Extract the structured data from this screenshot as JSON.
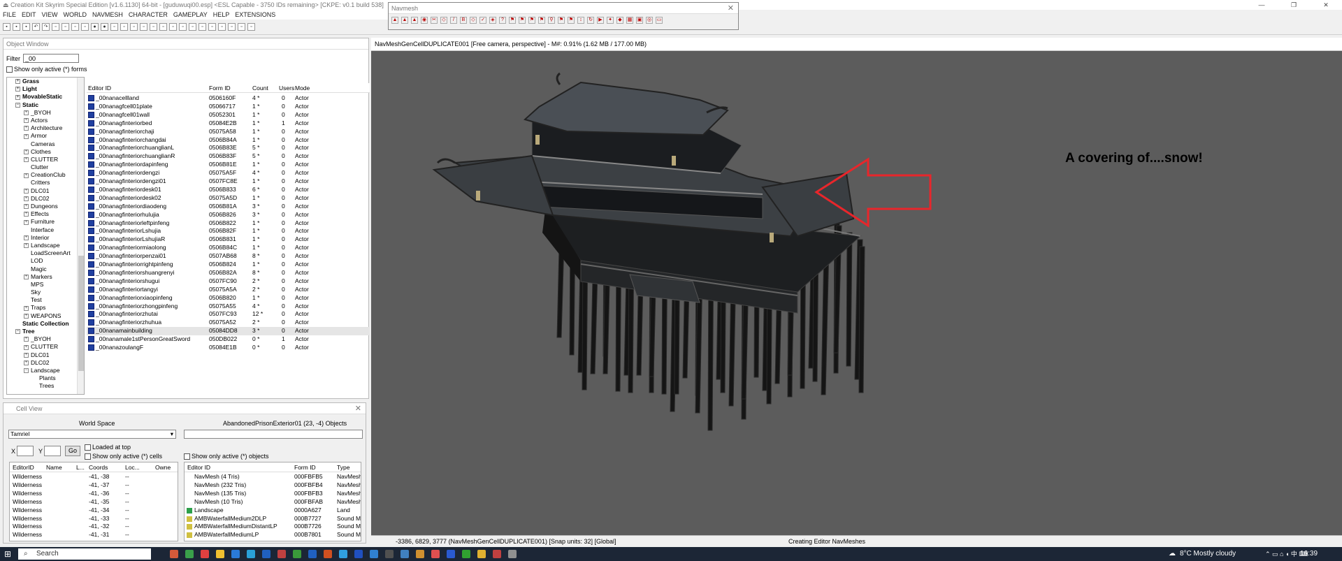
{
  "app": {
    "title": "Creation Kit Skyrim Special Edition [v1.6.1130] 64-bit - [guduwuqi00.esp] <ESL Capable - 3750 IDs remaining> [CKPE: v0.1 build 538]",
    "window_controls": [
      "—",
      "❐",
      "✕"
    ]
  },
  "menu": [
    "FILE",
    "EDIT",
    "VIEW",
    "WORLD",
    "NAVMESH",
    "CHARACTER",
    "GAMEPLAY",
    "HELP",
    "EXTENSIONS"
  ],
  "navmesh_toolbar": {
    "title": "Navmesh",
    "close": "✕"
  },
  "object_window": {
    "title": "Object Window",
    "filter_label": "Filter",
    "filter_value": "_00",
    "show_active": "Show only active (*) forms",
    "tree": [
      {
        "label": "Grass",
        "bold": true,
        "indent": 1,
        "exp": "+"
      },
      {
        "label": "Light",
        "bold": true,
        "indent": 1,
        "exp": "+"
      },
      {
        "label": "MovableStatic",
        "bold": true,
        "indent": 1,
        "exp": "+"
      },
      {
        "label": "Static",
        "bold": true,
        "indent": 1,
        "exp": "−"
      },
      {
        "label": "_BYOH",
        "indent": 2,
        "exp": "+"
      },
      {
        "label": "Actors",
        "indent": 2,
        "exp": "+"
      },
      {
        "label": "Architecture",
        "indent": 2,
        "exp": "+"
      },
      {
        "label": "Armor",
        "indent": 2,
        "exp": "+"
      },
      {
        "label": "Cameras",
        "indent": 2,
        "exp": ""
      },
      {
        "label": "Clothes",
        "indent": 2,
        "exp": "+"
      },
      {
        "label": "CLUTTER",
        "indent": 2,
        "exp": "+"
      },
      {
        "label": "Clutter",
        "indent": 2,
        "exp": ""
      },
      {
        "label": "CreationClub",
        "indent": 2,
        "exp": "+"
      },
      {
        "label": "Critters",
        "indent": 2,
        "exp": ""
      },
      {
        "label": "DLC01",
        "indent": 2,
        "exp": "+"
      },
      {
        "label": "DLC02",
        "indent": 2,
        "exp": "+"
      },
      {
        "label": "Dungeons",
        "indent": 2,
        "exp": "+"
      },
      {
        "label": "Effects",
        "indent": 2,
        "exp": "+"
      },
      {
        "label": "Furniture",
        "indent": 2,
        "exp": "+"
      },
      {
        "label": "Interface",
        "indent": 2,
        "exp": ""
      },
      {
        "label": "Interior",
        "indent": 2,
        "exp": "+"
      },
      {
        "label": "Landscape",
        "indent": 2,
        "exp": "+"
      },
      {
        "label": "LoadScreenArt",
        "indent": 2,
        "exp": ""
      },
      {
        "label": "LOD",
        "indent": 2,
        "exp": ""
      },
      {
        "label": "Magic",
        "indent": 2,
        "exp": ""
      },
      {
        "label": "Markers",
        "indent": 2,
        "exp": "+"
      },
      {
        "label": "MPS",
        "indent": 2,
        "exp": ""
      },
      {
        "label": "Sky",
        "indent": 2,
        "exp": ""
      },
      {
        "label": "Test",
        "indent": 2,
        "exp": ""
      },
      {
        "label": "Traps",
        "indent": 2,
        "exp": "+"
      },
      {
        "label": "WEAPONS",
        "indent": 2,
        "exp": "+"
      },
      {
        "label": "Static Collection",
        "bold": true,
        "indent": 1,
        "exp": ""
      },
      {
        "label": "Tree",
        "bold": true,
        "indent": 1,
        "exp": "−"
      },
      {
        "label": "_BYOH",
        "indent": 2,
        "exp": "+"
      },
      {
        "label": "CLUTTER",
        "indent": 2,
        "exp": "+"
      },
      {
        "label": "DLC01",
        "indent": 2,
        "exp": "+"
      },
      {
        "label": "DLC02",
        "indent": 2,
        "exp": "+"
      },
      {
        "label": "Landscape",
        "indent": 2,
        "exp": "−"
      },
      {
        "label": "Plants",
        "indent": 3,
        "exp": ""
      },
      {
        "label": "Trees",
        "indent": 3,
        "exp": ""
      }
    ],
    "columns": [
      "Editor ID",
      "Form ID",
      "Count",
      "Users",
      "Mode"
    ],
    "rows": [
      [
        "_00nanacellland",
        "0506160F",
        "4 *",
        "0",
        "Actor"
      ],
      [
        "_00nanagfcell01plate",
        "05066717",
        "1 *",
        "0",
        "Actor"
      ],
      [
        "_00nanagfcell01wall",
        "05052301",
        "1 *",
        "0",
        "Actor"
      ],
      [
        "_00nanagfinteriorbed",
        "05084E2B",
        "1 *",
        "1",
        "Actor"
      ],
      [
        "_00nanagfinteriorchaji",
        "05075A58",
        "1 *",
        "0",
        "Actor"
      ],
      [
        "_00nanagfinteriorchangdai",
        "0506B84A",
        "1 *",
        "0",
        "Actor"
      ],
      [
        "_00nanagfinteriorchuanglianL",
        "0506B83E",
        "5 *",
        "0",
        "Actor"
      ],
      [
        "_00nanagfinteriorchuanglianR",
        "0506B83F",
        "5 *",
        "0",
        "Actor"
      ],
      [
        "_00nanagfinteriordapinfeng",
        "0506B81E",
        "1 *",
        "0",
        "Actor"
      ],
      [
        "_00nanagfinteriordengzi",
        "05075A5F",
        "4 *",
        "0",
        "Actor"
      ],
      [
        "_00nanagfinteriordengzi01",
        "0507FC8E",
        "1 *",
        "0",
        "Actor"
      ],
      [
        "_00nanagfinteriordesk01",
        "0506B833",
        "6 *",
        "0",
        "Actor"
      ],
      [
        "_00nanagfinteriordesk02",
        "05075A5D",
        "1 *",
        "0",
        "Actor"
      ],
      [
        "_00nanagfinteriordiaodeng",
        "0506B81A",
        "3 *",
        "0",
        "Actor"
      ],
      [
        "_00nanagfinteriorhulujia",
        "0506B826",
        "3 *",
        "0",
        "Actor"
      ],
      [
        "_00nanagfinteriorleftpinfeng",
        "0506B822",
        "1 *",
        "0",
        "Actor"
      ],
      [
        "_00nanagfinteriorLshujia",
        "0506B82F",
        "1 *",
        "0",
        "Actor"
      ],
      [
        "_00nanagfinteriorLshujiaR",
        "0506B831",
        "1 *",
        "0",
        "Actor"
      ],
      [
        "_00nanagfinteriormiaolong",
        "0506B84C",
        "1 *",
        "0",
        "Actor"
      ],
      [
        "_00nanagfinteriorpenzai01",
        "0507AB68",
        "8 *",
        "0",
        "Actor"
      ],
      [
        "_00nanagfinteriorrightpinfeng",
        "0506B824",
        "1 *",
        "0",
        "Actor"
      ],
      [
        "_00nanagfinteriorshuangrenyi",
        "0506B82A",
        "8 *",
        "0",
        "Actor"
      ],
      [
        "_00nanagfinteriorshugui",
        "0507FC90",
        "2 *",
        "0",
        "Actor"
      ],
      [
        "_00nanagfinteriortangyi",
        "05075A5A",
        "2 *",
        "0",
        "Actor"
      ],
      [
        "_00nanagfinteriorxiaopinfeng",
        "0506B820",
        "1 *",
        "0",
        "Actor"
      ],
      [
        "_00nanagfinteriorzhongpinfeng",
        "05075A55",
        "4 *",
        "0",
        "Actor"
      ],
      [
        "_00nanagfinteriorzhutai",
        "0507FC93",
        "12 *",
        "0",
        "Actor"
      ],
      [
        "_00nanagfinteriorzhuhua",
        "05075A52",
        "2 *",
        "0",
        "Actor"
      ],
      [
        "_00nanamainbuilding",
        "05084DD8",
        "3 *",
        "0",
        "Actor"
      ],
      [
        "_00nanamale1stPersonGreatSword",
        "050DB022",
        "0 *",
        "1",
        "Actor"
      ],
      [
        "_00nanazoulangF",
        "05084E1B",
        "0 *",
        "0",
        "Actor"
      ]
    ]
  },
  "cell_view": {
    "title": "Cell View",
    "world_space_label": "World Space",
    "world_space_value": "Tamriel",
    "objects_label": "AbandonedPrisonExterior01 (23, -4) Objects",
    "x_label": "X",
    "y_label": "Y",
    "go": "Go",
    "loaded_at_top": "Loaded at top",
    "show_active_cells": "Show only active (*) cells",
    "show_active_objects": "Show only active (*) objects",
    "cell_columns": [
      "EditorID",
      "Name",
      "L...",
      "Coords",
      "Loc...",
      "Owne"
    ],
    "cells": [
      [
        "Wilderness",
        "",
        "",
        "-41, -38",
        "--",
        ""
      ],
      [
        "Wilderness",
        "",
        "",
        "-41, -37",
        "--",
        ""
      ],
      [
        "Wilderness",
        "",
        "",
        "-41, -36",
        "--",
        ""
      ],
      [
        "Wilderness",
        "",
        "",
        "-41, -35",
        "--",
        ""
      ],
      [
        "Wilderness",
        "",
        "",
        "-41, -34",
        "--",
        ""
      ],
      [
        "Wilderness",
        "",
        "",
        "-41, -33",
        "--",
        ""
      ],
      [
        "Wilderness",
        "",
        "",
        "-41, -32",
        "--",
        ""
      ],
      [
        "Wilderness",
        "",
        "",
        "-41, -31",
        "--",
        ""
      ]
    ],
    "object_columns": [
      "Editor ID",
      "Form ID",
      "Type"
    ],
    "objects": [
      [
        "NavMesh  (4 Tris)",
        "000FBFB5",
        "NavMesh"
      ],
      [
        "NavMesh  (232 Tris)",
        "000FBFB4",
        "NavMesh"
      ],
      [
        "NavMesh  (135 Tris)",
        "000FBFB3",
        "NavMesh"
      ],
      [
        "NavMesh  (10 Tris)",
        "000FBFAB",
        "NavMesh"
      ],
      [
        "Landscape",
        "0000A627",
        "Land"
      ],
      [
        "AMBWaterfallMedium2DLP",
        "000B7727",
        "Sound Mar"
      ],
      [
        "AMBWaterfallMediumDistantLP",
        "000B7726",
        "Sound Mar"
      ],
      [
        "AMBWaterfallMediumLP",
        "000B7801",
        "Sound Mar"
      ]
    ]
  },
  "viewport": {
    "header": "NavMeshGenCellDUPLICATE001 [Free camera, perspective] - M#: 0.91% (1.62 MB / 177.00 MB)",
    "annotation": "A covering of....snow!",
    "arrow_color": "#e8262b",
    "bg_color": "#5c5c5c"
  },
  "status": {
    "coords": "-3386, 6829, 3777 (NavMeshGenCellDUPLICATE001) [Snap units: 32] [Global]",
    "message": "Creating Editor NavMeshes"
  },
  "taskbar": {
    "search": "Search",
    "weather": "8°C  Mostly cloudy",
    "time": "16:39"
  }
}
